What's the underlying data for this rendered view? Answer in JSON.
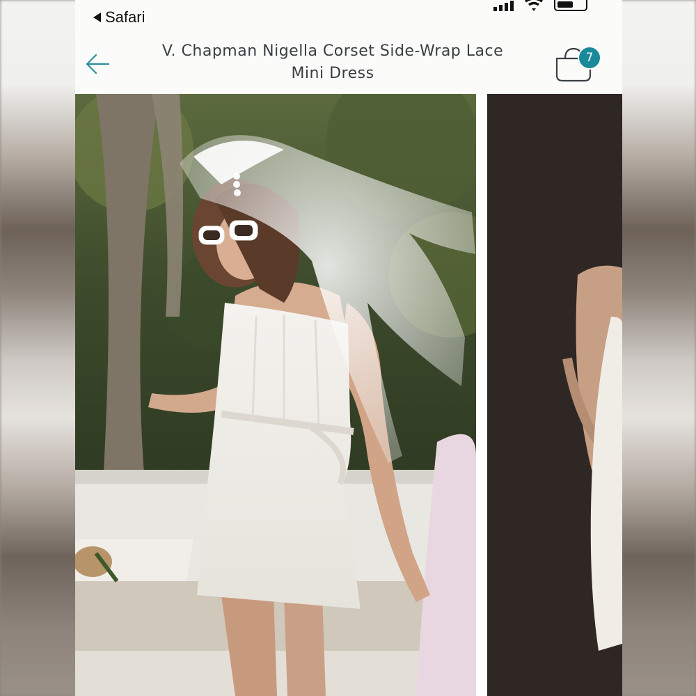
{
  "status_bar": {
    "back_app_label": "Safari"
  },
  "nav": {
    "title": "V. Chapman Nigella Corset Side-Wrap Lace Mini Dress",
    "cart_count": "7"
  },
  "gallery": {
    "images": [
      {
        "icon": "product-photo-model-veil"
      },
      {
        "icon": "product-photo-side-view"
      }
    ]
  },
  "colors": {
    "accent": "#1a8a9a",
    "title_text": "#3a3f44",
    "header_bg": "#fbfbf9"
  }
}
